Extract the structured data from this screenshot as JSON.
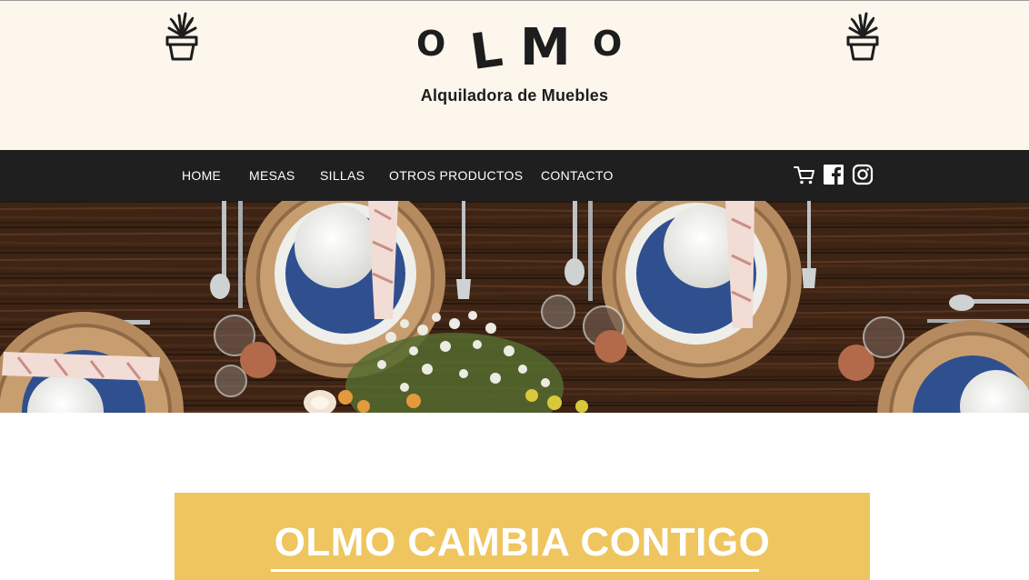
{
  "header": {
    "logo_letters": [
      "O",
      "L",
      "M",
      "O"
    ],
    "tagline": "Alquiladora de Muebles",
    "decor_icons": [
      "plant-pot-icon",
      "plant-pot-icon"
    ]
  },
  "nav": {
    "items": [
      {
        "label": "HOME"
      },
      {
        "label": "MESAS"
      },
      {
        "label": "SILLAS"
      },
      {
        "label": "OTROS PRODUCTOS"
      },
      {
        "label": "CONTACTO"
      }
    ],
    "icons": [
      "cart-icon",
      "facebook-icon",
      "instagram-icon"
    ]
  },
  "hero": {
    "image": "table-setting-photo"
  },
  "banner": {
    "title": "OLMO CAMBIA CONTIGO"
  },
  "colors": {
    "header_bg": "#fcf6ec",
    "nav_bg": "#1f1f1f",
    "banner_bg": "#efc55f",
    "text_dark": "#1d1d1d"
  }
}
